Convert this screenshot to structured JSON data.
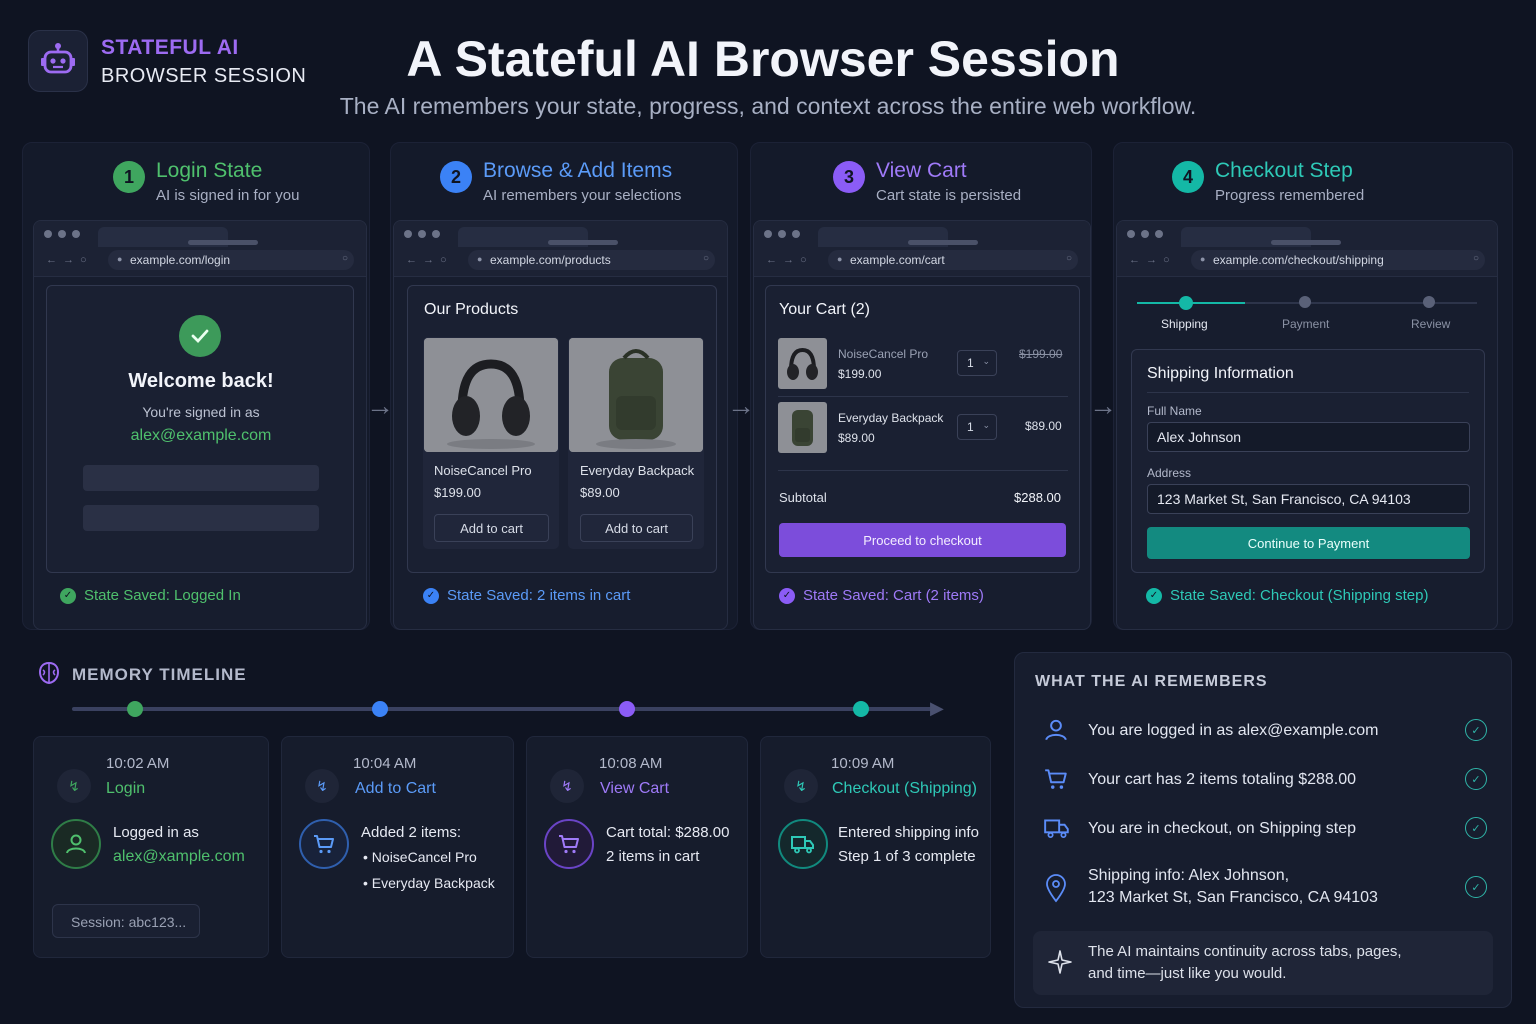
{
  "brand": {
    "line1": "STATEFUL AI",
    "line2": "BROWSER SESSION",
    "icon": "robot-icon"
  },
  "header": {
    "title": "A Stateful AI Browser Session",
    "subtitle": "The AI remembers your state, progress, and context across the entire web workflow."
  },
  "colors": {
    "green": "#3fa65f",
    "blue": "#3b82f6",
    "purple": "#8b5cf6",
    "teal": "#14b8a6"
  },
  "steps": [
    {
      "num": "1",
      "title": "Login State",
      "sub": "AI is signed in for you"
    },
    {
      "num": "2",
      "title": "Browse & Add Items",
      "sub": "AI remembers your selections"
    },
    {
      "num": "3",
      "title": "View Cart",
      "sub": "Cart state is persisted"
    },
    {
      "num": "4",
      "title": "Checkout Step",
      "sub": "Progress remembered"
    }
  ],
  "login": {
    "url": "example.com/login",
    "welcome": "Welcome back!",
    "signed_in_as": "You're signed in as",
    "email": "alex@example.com",
    "state": "State Saved: Logged In"
  },
  "products": {
    "url": "example.com/products",
    "heading": "Our Products",
    "items": [
      {
        "name": "NoiseCancel Pro",
        "price": "$199.00",
        "button": "Add to cart"
      },
      {
        "name": "Everyday Backpack",
        "price": "$89.00",
        "button": "Add to cart"
      }
    ],
    "state": "State Saved: 2 items in cart"
  },
  "cart": {
    "url": "example.com/cart",
    "heading": "Your Cart (2)",
    "items": [
      {
        "name": "NoiseCancel Pro",
        "price": "$199.00",
        "qty": "1",
        "line_total": "$199.00"
      },
      {
        "name": "Everyday Backpack",
        "price": "$89.00",
        "qty": "1",
        "line_total": "$89.00"
      }
    ],
    "subtotal_label": "Subtotal",
    "subtotal": "$288.00",
    "button": "Proceed to checkout",
    "state": "State Saved: Cart (2 items)"
  },
  "checkout": {
    "url": "example.com/checkout/shipping",
    "progress": [
      "Shipping",
      "Payment",
      "Review"
    ],
    "heading": "Shipping Information",
    "name_label": "Full Name",
    "name_value": "Alex Johnson",
    "address_label": "Address",
    "address_value": "123 Market St, San Francisco, CA 94103",
    "button": "Continue to Payment",
    "state": "State Saved: Checkout (Shipping step)"
  },
  "timeline": {
    "title": "MEMORY TIMELINE",
    "events": [
      {
        "time": "10:02 AM",
        "label": "Login",
        "line1": "Logged in as",
        "line2": "alex@xample.com",
        "session": "Session: abc123..."
      },
      {
        "time": "10:04 AM",
        "label": "Add to Cart",
        "line1": "Added 2 items:",
        "bullets": [
          "NoiseCancel Pro",
          "Everyday Backpack"
        ]
      },
      {
        "time": "10:08 AM",
        "label": "View Cart",
        "line1": "Cart total: $288.00",
        "line2": "2 items in cart"
      },
      {
        "time": "10:09 AM",
        "label": "Checkout (Shipping)",
        "line1": "Entered shipping info",
        "line2": "Step 1 of 3 complete"
      }
    ]
  },
  "remembers": {
    "title": "WHAT THE AI REMEMBERS",
    "items": [
      {
        "text": "You are logged in as alex@example.com",
        "icon": "user-icon"
      },
      {
        "text": "Your cart has 2 items totaling $288.00",
        "icon": "cart-icon"
      },
      {
        "text": "You are in checkout, on Shipping step",
        "icon": "truck-icon"
      },
      {
        "text": "Shipping info: Alex Johnson,",
        "text2": "123 Market St, San Francisco, CA 94103",
        "icon": "location-pin-icon"
      }
    ],
    "note_line1": "The AI maintains continuity across tabs, pages,",
    "note_line2": "and time—just like you would."
  }
}
